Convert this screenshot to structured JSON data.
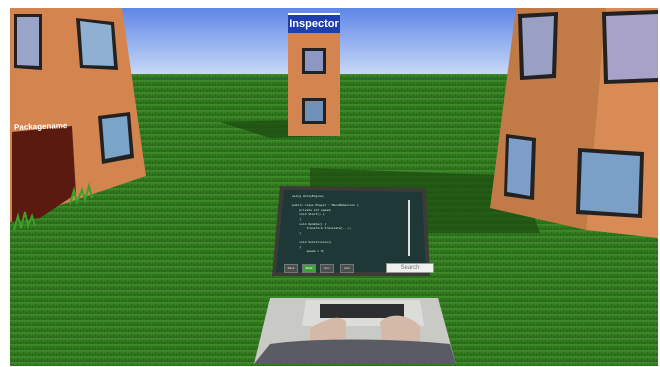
{
  "buildings": {
    "inspector_label": "Inspector",
    "packagename_label": "Packagename"
  },
  "terminal": {
    "code_lines": [
      "using UnityEngine;",
      "",
      "public class Player : MonoBehaviour {",
      "    private int speed;",
      "    void Start() {",
      "    }",
      "    void Update() {",
      "        transform.Translate(...);",
      "    }",
      "",
      "    void OnCollision()",
      "    {",
      "        speed = 0;",
      "    }",
      "    public static void Main() {",
      "    }",
      "}"
    ],
    "toolbar_buttons": [
      "Back",
      "Build",
      "Run",
      "Edit"
    ],
    "search_label": "Search"
  },
  "colors": {
    "sky_top": "#5f86e8",
    "sky_bottom": "#c9dcf6",
    "grass": "#2f7d1e",
    "building": "#d9895a",
    "terminal_panel": "#1d3836",
    "sign_blue": "#1f3fae",
    "door": "#5a1a10"
  }
}
